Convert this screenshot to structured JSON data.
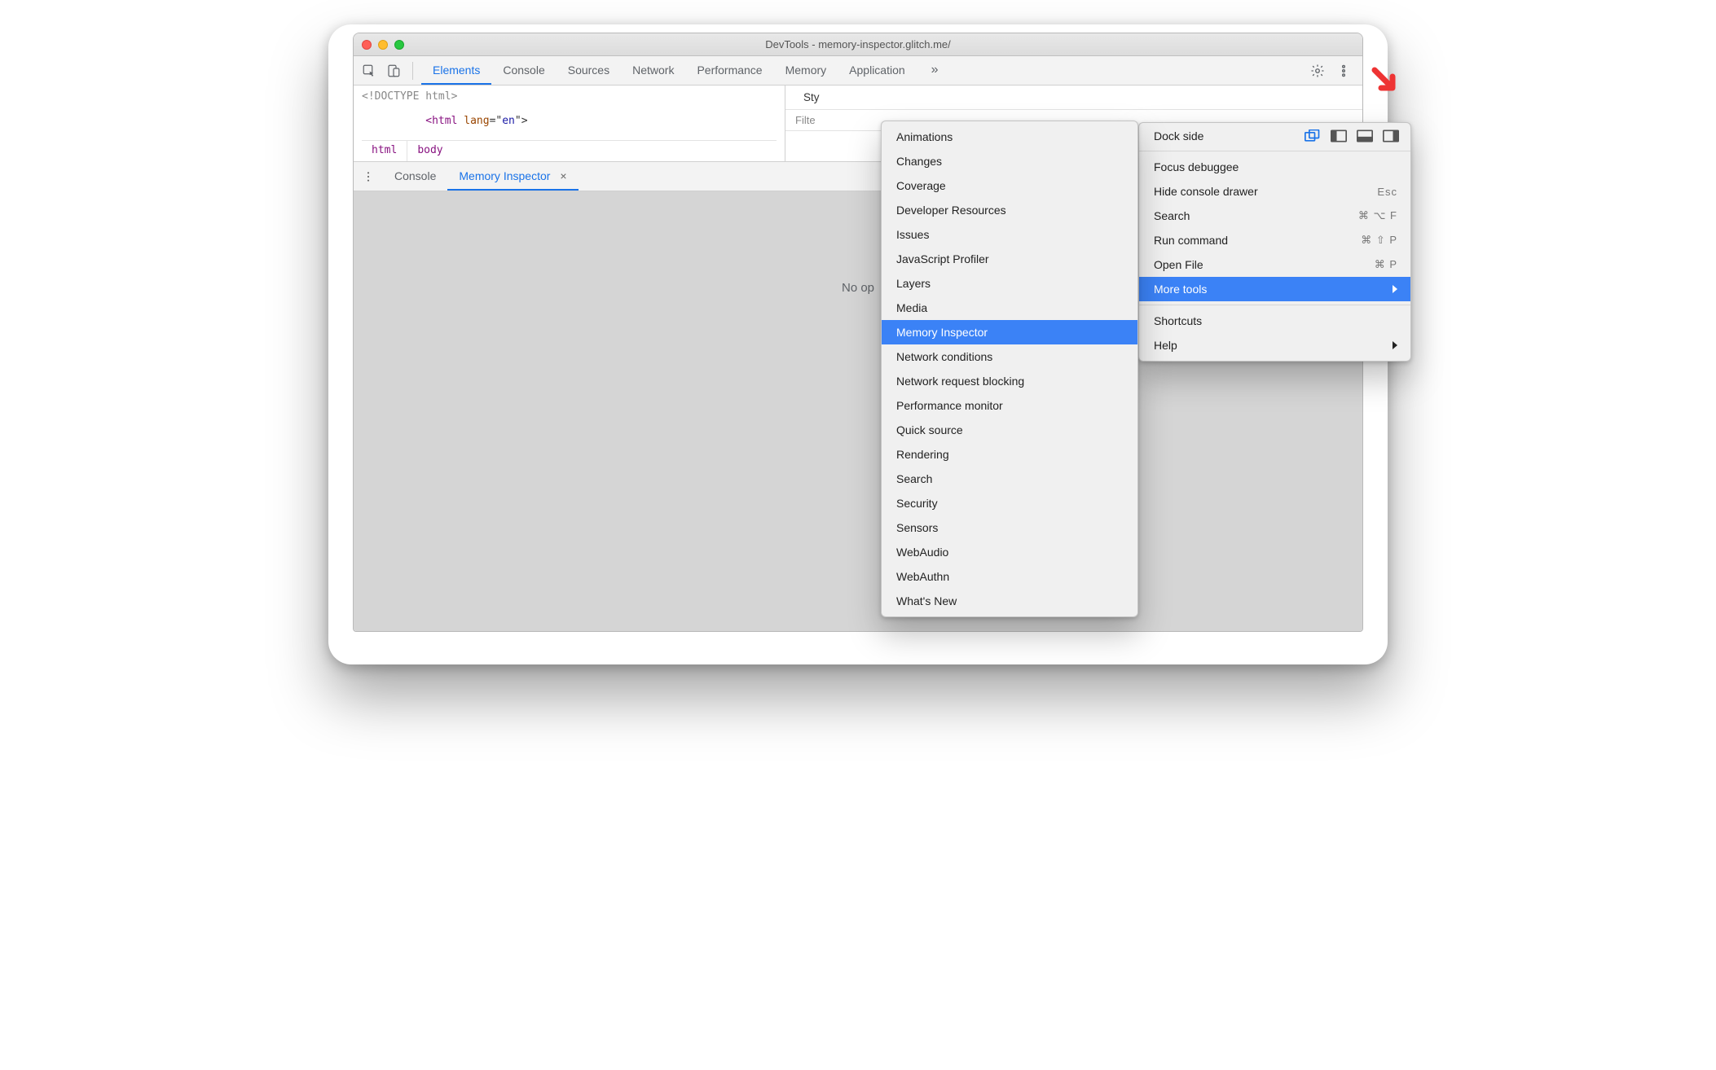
{
  "window": {
    "title": "DevTools - memory-inspector.glitch.me/"
  },
  "toolbar": {
    "tabs": [
      "Elements",
      "Console",
      "Sources",
      "Network",
      "Performance",
      "Memory",
      "Application"
    ],
    "active_index": 0,
    "more_label": "»"
  },
  "dom": {
    "line1_doctype": "<!DOCTYPE html>",
    "line2_open": "<",
    "line2_tag": "html",
    "line2_space": " ",
    "line2_attr": "lang",
    "line2_eq": "=\"",
    "line2_val": "en",
    "line2_close": "\">",
    "breadcrumbs": [
      "html",
      "body"
    ]
  },
  "styles": {
    "tab_label": "Sty",
    "filter_label": "Filte"
  },
  "drawer": {
    "tabs": [
      {
        "label": "Console",
        "active": false,
        "closeable": false
      },
      {
        "label": "Memory Inspector",
        "active": true,
        "closeable": true
      }
    ],
    "empty_text": "No op"
  },
  "main_menu": {
    "dock_label": "Dock side",
    "items_top": [
      "Focus debuggee"
    ],
    "items_mid": [
      {
        "label": "Hide console drawer",
        "shortcut": "Esc"
      },
      {
        "label": "Search",
        "shortcut": "⌘ ⌥ F"
      },
      {
        "label": "Run command",
        "shortcut": "⌘ ⇧ P"
      },
      {
        "label": "Open File",
        "shortcut": "⌘ P"
      }
    ],
    "more_tools": "More tools",
    "items_bottom": [
      "Shortcuts",
      "Help"
    ]
  },
  "submenu": {
    "items": [
      "Animations",
      "Changes",
      "Coverage",
      "Developer Resources",
      "Issues",
      "JavaScript Profiler",
      "Layers",
      "Media",
      "Memory Inspector",
      "Network conditions",
      "Network request blocking",
      "Performance monitor",
      "Quick source",
      "Rendering",
      "Search",
      "Security",
      "Sensors",
      "WebAudio",
      "WebAuthn",
      "What's New"
    ],
    "selected_index": 8
  }
}
